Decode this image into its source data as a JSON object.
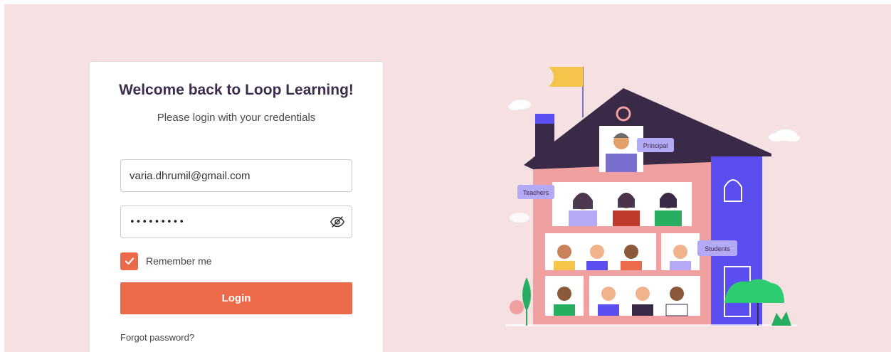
{
  "login": {
    "title": "Welcome back to Loop Learning!",
    "subtitle": "Please login with your credentials",
    "email_value": "varia.dhrumil@gmail.com",
    "password_masked": "•••••••••",
    "remember_label": "Remember me",
    "remember_checked": true,
    "login_label": "Login",
    "forgot_label": "Forgot password?"
  },
  "illustration": {
    "principal_label": "Principal",
    "teachers_label": "Teachers",
    "students_label": "Students"
  },
  "colors": {
    "page_background": "#f5e1e2",
    "accent": "#ec6a4a",
    "title_text": "#3d2d4c",
    "house_pink": "#f0a0a0",
    "roof": "#3a2a48",
    "tower_blue": "#5b4ef0"
  },
  "icons": [
    "eye-slash-icon",
    "check-icon"
  ]
}
